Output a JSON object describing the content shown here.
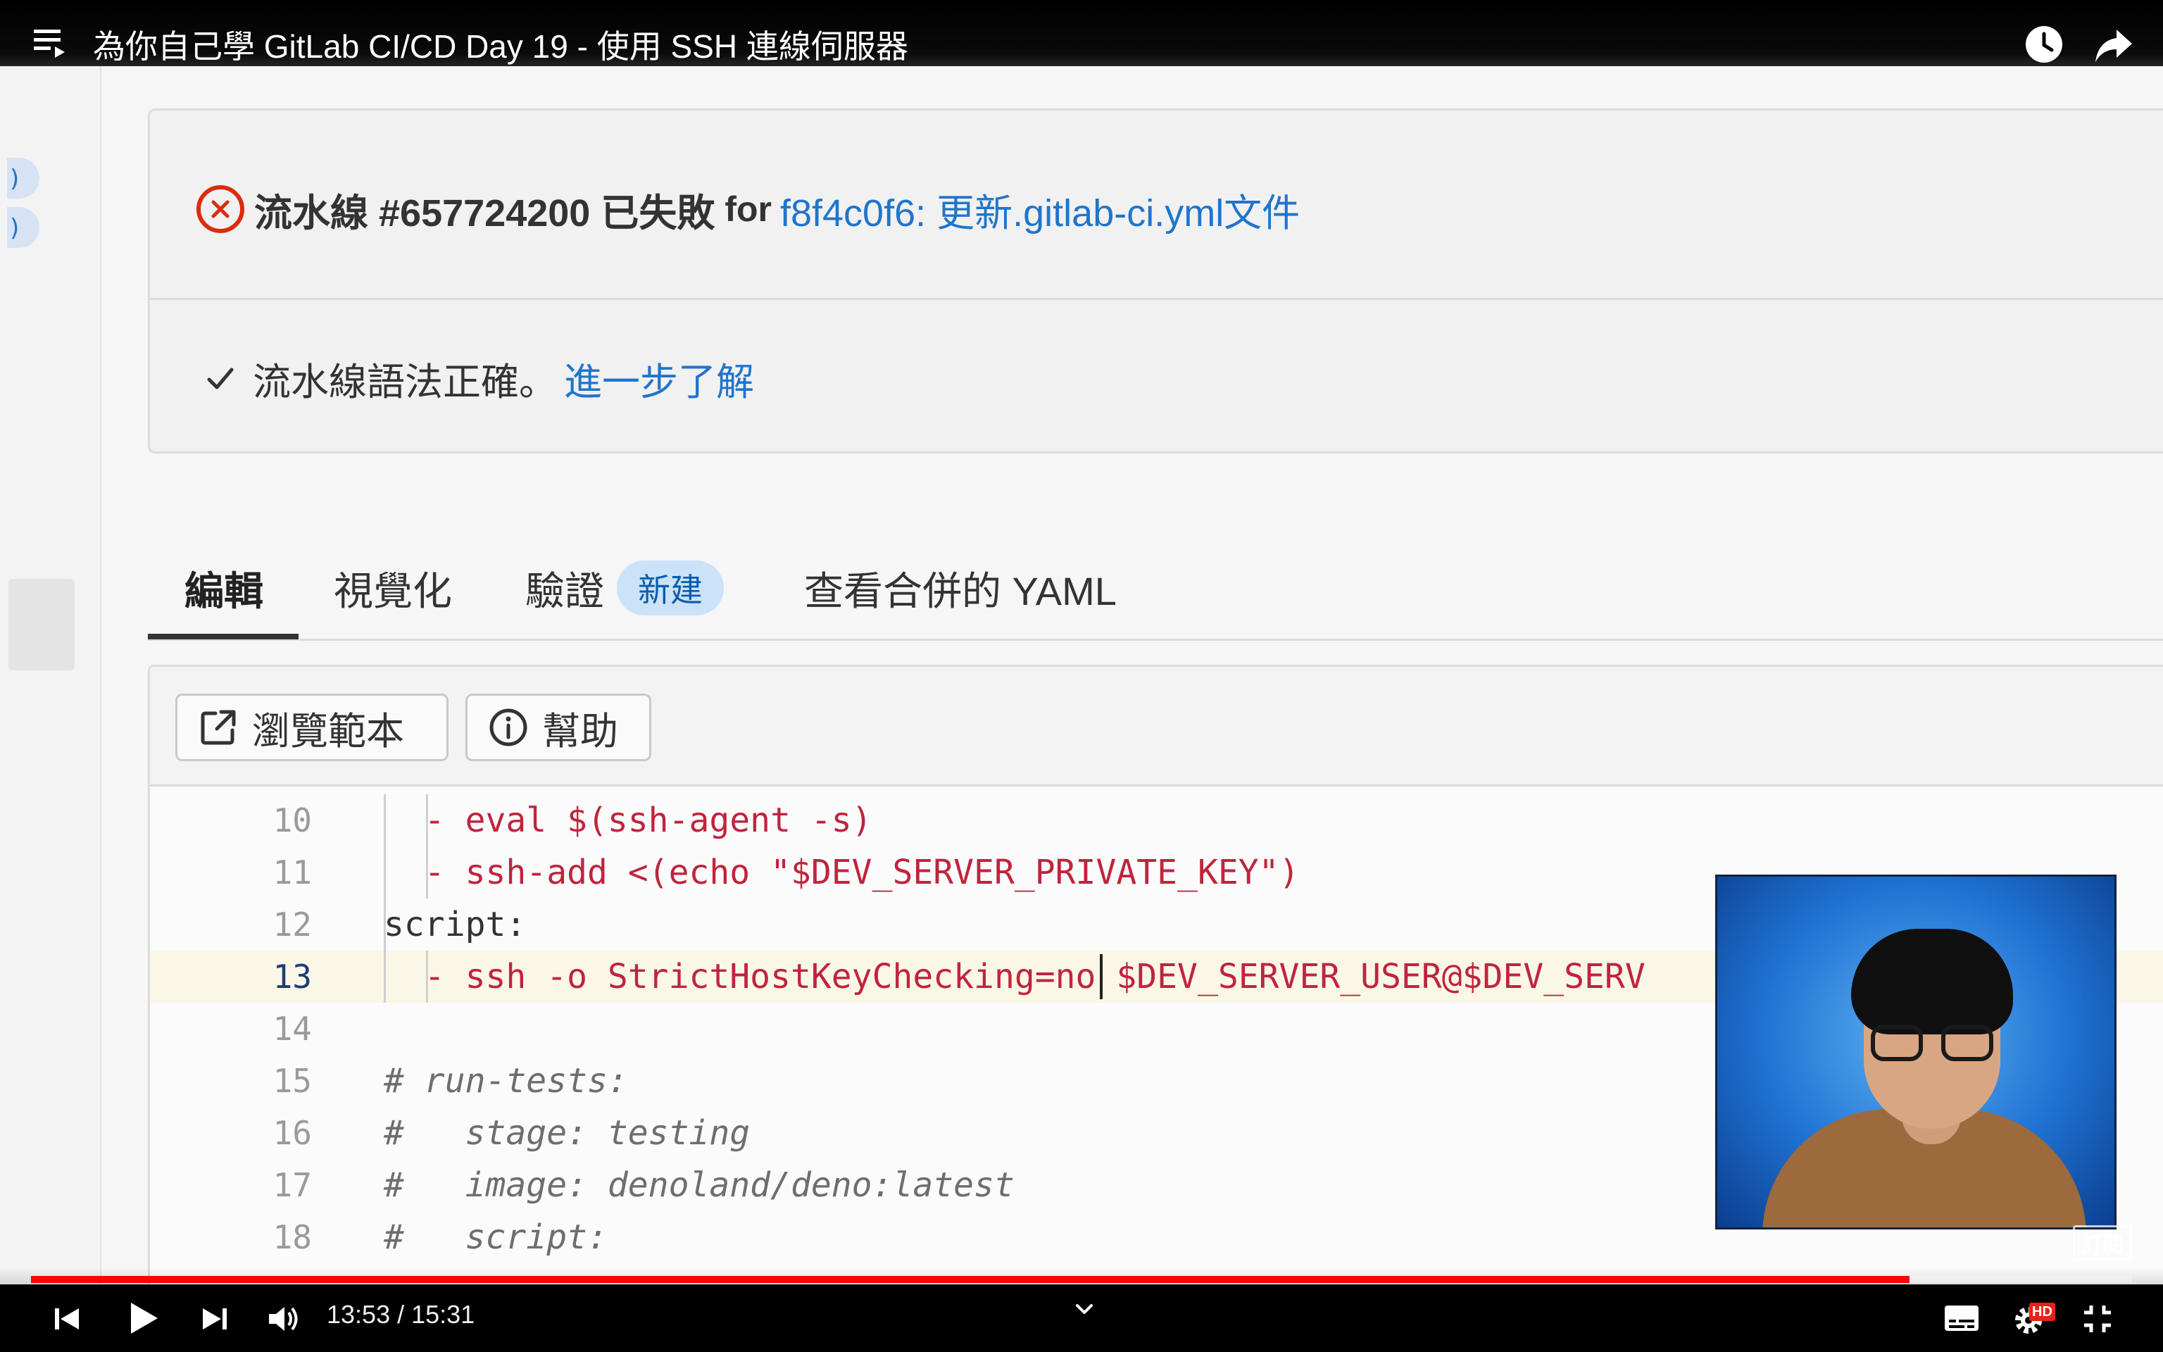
{
  "video": {
    "title": "為你自己學 GitLab CI/CD Day 19 - 使用 SSH 連線伺服器",
    "current_time": "13:53",
    "duration": "15:31",
    "time_display": "13:53 / 15:31",
    "progress_fraction": 0.894,
    "quality_badge": "HD",
    "subscribe_watermark": "訂閱"
  },
  "pipeline": {
    "status_text": "流水線 #657724200 已失敗",
    "for_word": "for",
    "commit_link": "f8f4c0f6: 更新.gitlab-ci.yml文件",
    "validation_text": "流水線語法正確。",
    "learn_more_link": "進一步了解"
  },
  "tabs": [
    {
      "label": "編輯",
      "active": true
    },
    {
      "label": "視覺化",
      "active": false
    },
    {
      "label": "驗證",
      "badge": "新建",
      "active": false
    },
    {
      "label": "查看合併的 YAML",
      "active": false
    }
  ],
  "toolbar": {
    "browse_label": "瀏覽範本",
    "help_label": "幫助"
  },
  "code": [
    {
      "n": "10",
      "parts": [
        {
          "t": "  - eval $(ssh-agent -s)",
          "c": "#c0243d"
        }
      ],
      "indent_guides": 2
    },
    {
      "n": "11",
      "parts": [
        {
          "t": "  - ssh-add <(echo \"$DEV_SERVER_PRIVATE_KEY\")",
          "c": "#c0243d"
        }
      ],
      "indent_guides": 2
    },
    {
      "n": "12",
      "parts": [
        {
          "t": "script:",
          "c": "#333333"
        }
      ],
      "indent_guides": 1
    },
    {
      "n": "13",
      "parts": [
        {
          "t": "  - ssh -o StrictHostKeyChecking=no",
          "c": "#c0243d"
        },
        {
          "t": " $DEV_SERVER_USER@$DEV_SERV",
          "c": "#c0243d"
        }
      ],
      "indent_guides": 2,
      "active": true
    },
    {
      "n": "14",
      "parts": [
        {
          "t": "",
          "c": "#333333"
        }
      ],
      "indent_guides": 0
    },
    {
      "n": "15",
      "parts": [
        {
          "t": "# run-tests:",
          "c": "#6e6e6e"
        }
      ],
      "indent_guides": 0,
      "italic": true
    },
    {
      "n": "16",
      "parts": [
        {
          "t": "#   stage: testing",
          "c": "#6e6e6e"
        }
      ],
      "indent_guides": 0,
      "italic": true
    },
    {
      "n": "17",
      "parts": [
        {
          "t": "#   image: denoland/deno:latest",
          "c": "#6e6e6e"
        }
      ],
      "indent_guides": 0,
      "italic": true
    },
    {
      "n": "18",
      "parts": [
        {
          "t": "#   script:",
          "c": "#6e6e6e"
        }
      ],
      "indent_guides": 0,
      "italic": true
    }
  ],
  "icons": {
    "playlist": "playlist-icon",
    "watch_later": "clock-icon",
    "share": "share-arrow-icon",
    "previous": "skip-previous-icon",
    "play": "play-icon",
    "next": "skip-next-icon",
    "volume": "volume-icon",
    "chapters": "chevron-down-icon",
    "subtitles": "subtitles-icon",
    "settings": "gear-icon",
    "exit_fullscreen": "exit-fullscreen-icon",
    "pipeline_failed": "x-circle-icon",
    "syntax_ok": "checkmark-icon",
    "external_link": "external-link-icon",
    "info": "info-icon"
  },
  "colors": {
    "link": "#1f75cb",
    "failed": "#dd2b0e",
    "progress": "#ff0000",
    "code_string": "#c0243d",
    "badge_bg": "#cbe2f9"
  }
}
